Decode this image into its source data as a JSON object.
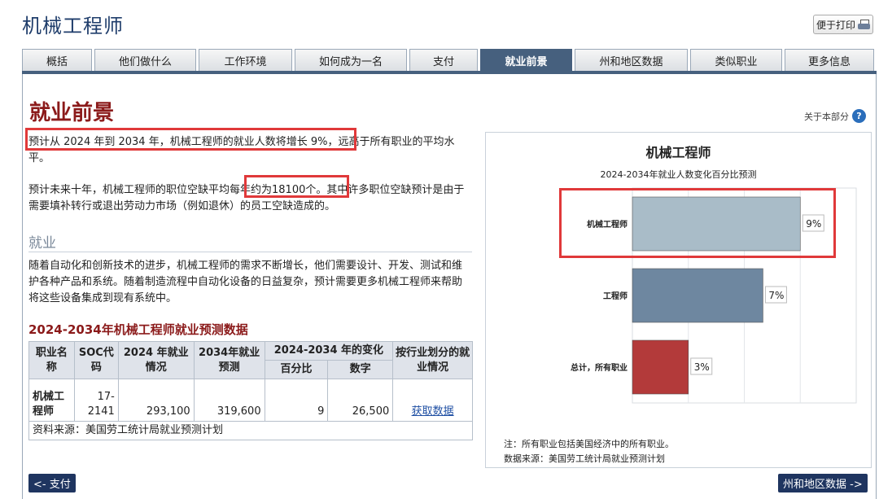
{
  "header": {
    "title": "机械工程师",
    "print_label": "便于打印"
  },
  "tabs": [
    {
      "label": "概括",
      "active": false
    },
    {
      "label": "他们做什么",
      "active": false
    },
    {
      "label": "工作环境",
      "active": false
    },
    {
      "label": "如何成为一名",
      "active": false
    },
    {
      "label": "支付",
      "active": false
    },
    {
      "label": "就业前景",
      "active": true
    },
    {
      "label": "州和地区数据",
      "active": false
    },
    {
      "label": "类似职业",
      "active": false
    },
    {
      "label": "更多信息",
      "active": false
    }
  ],
  "main": {
    "section_title": "就业前景",
    "about_label": "关于本部分",
    "para1": "预计从 2024 年到 2034 年，机械工程师的就业人数将增长 9%，远高于所有职业的平均水平。",
    "para2": "预计未来十年，机械工程师的职位空缺平均每年约为18100个。其中许多职位空缺预计是由于需要填补转行或退出劳动力市场（例如退休）的员工空缺造成的。",
    "employment_heading": "就业",
    "employment_text": "随着自动化和创新技术的进步，机械工程师的需求不断增长，他们需要设计、开发、测试和维护各种产品和系统。随着制造流程中自动化设备的日益复杂，预计需要更多机械工程师来帮助将这些设备集成到现有系统中。"
  },
  "table": {
    "title": "2024-2034年机械工程师就业预测数据",
    "headers": {
      "occupation": "职业名称",
      "soc": "SOC代码",
      "emp2024": "2024 年就业情况",
      "emp2034": "2034年就业预测",
      "change": "2024-2034 年的变化",
      "percent": "百分比",
      "numeric": "数字",
      "by_industry": "按行业划分的就业情况"
    },
    "row": {
      "occupation": "机械工程师",
      "soc": "17-2141",
      "emp2024": "293,100",
      "emp2034": "319,600",
      "percent": "9",
      "numeric": "26,500",
      "link": "获取数据"
    },
    "source": "资料来源：美国劳工统计局就业预测计划"
  },
  "chart_data": {
    "type": "bar",
    "orientation": "horizontal",
    "title": "机械工程师",
    "subtitle": "2024-2034年就业人数变化百分比预测",
    "categories": [
      "机械工程师",
      "工程师",
      "总计，所有职业"
    ],
    "values": [
      9,
      7,
      3
    ],
    "value_labels": [
      "9%",
      "7%",
      "3%"
    ],
    "colors": [
      "#a9bcc8",
      "#6e87a0",
      "#b33a3a"
    ],
    "xlim": [
      0,
      12
    ],
    "grid": true
  },
  "chart_notes": {
    "note": "注：所有职业包括美国经济中的所有职业。",
    "source": "数据来源：美国劳工统计局就业预测计划"
  },
  "nav": {
    "prev": "<- 支付",
    "next": "州和地区数据 ->"
  }
}
